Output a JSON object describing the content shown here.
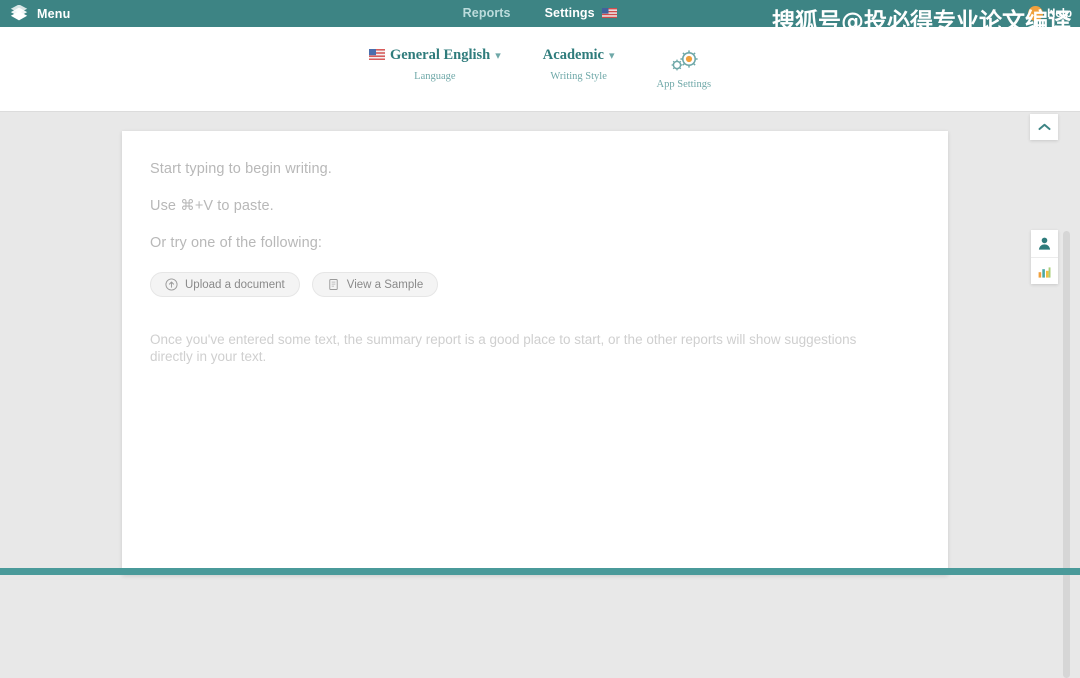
{
  "header": {
    "menu_label": "Menu",
    "logo_icon": "stacked-pages-logo",
    "nav": [
      {
        "label": "Reports",
        "active": false
      },
      {
        "label": "Settings",
        "active": true,
        "flag_icon": "us-flag-icon"
      }
    ],
    "help_label": "Help",
    "help_icon": "help-circle-icon",
    "watermark_text": "搜狐号@投必得专业论文编译",
    "background_color": "#3d8484",
    "active_underline_color": "#e0a458"
  },
  "settings_bar": {
    "language": {
      "value": "General English",
      "caption": "Language",
      "flag_icon": "us-flag-icon",
      "chevron_icon": "chevron-down-icon"
    },
    "writing_style": {
      "value": "Academic",
      "caption": "Writing Style",
      "chevron_icon": "chevron-down-icon"
    },
    "app_settings": {
      "caption": "App Settings",
      "icon": "gears-icon"
    },
    "accent_color": "#2f7c7c",
    "caption_color": "#6fa8a8"
  },
  "editor": {
    "placeholder_lines": [
      "Start typing to begin writing.",
      "Use ⌘+V to paste.",
      "Or try one of the following:"
    ],
    "buttons": [
      {
        "label": "Upload a document",
        "icon": "upload-circle-icon"
      },
      {
        "label": "View a Sample",
        "icon": "document-icon"
      }
    ],
    "hint": "Once you've entered some text, the summary report is a good place to start, or the other reports will show suggestions directly in your text.",
    "placeholder_color": "#b8b8b8",
    "card_background": "#ffffff",
    "page_background": "#e8e8e8"
  },
  "right_rail": {
    "collapse_icon": "chevron-up-icon",
    "buttons": [
      {
        "icon": "person-icon",
        "name": "audience-report"
      },
      {
        "icon": "bar-chart-icon",
        "name": "statistics-report"
      }
    ],
    "scrollbar": "vertical-scrollbar"
  },
  "footer": {
    "background_color": "#4a9a9a"
  }
}
